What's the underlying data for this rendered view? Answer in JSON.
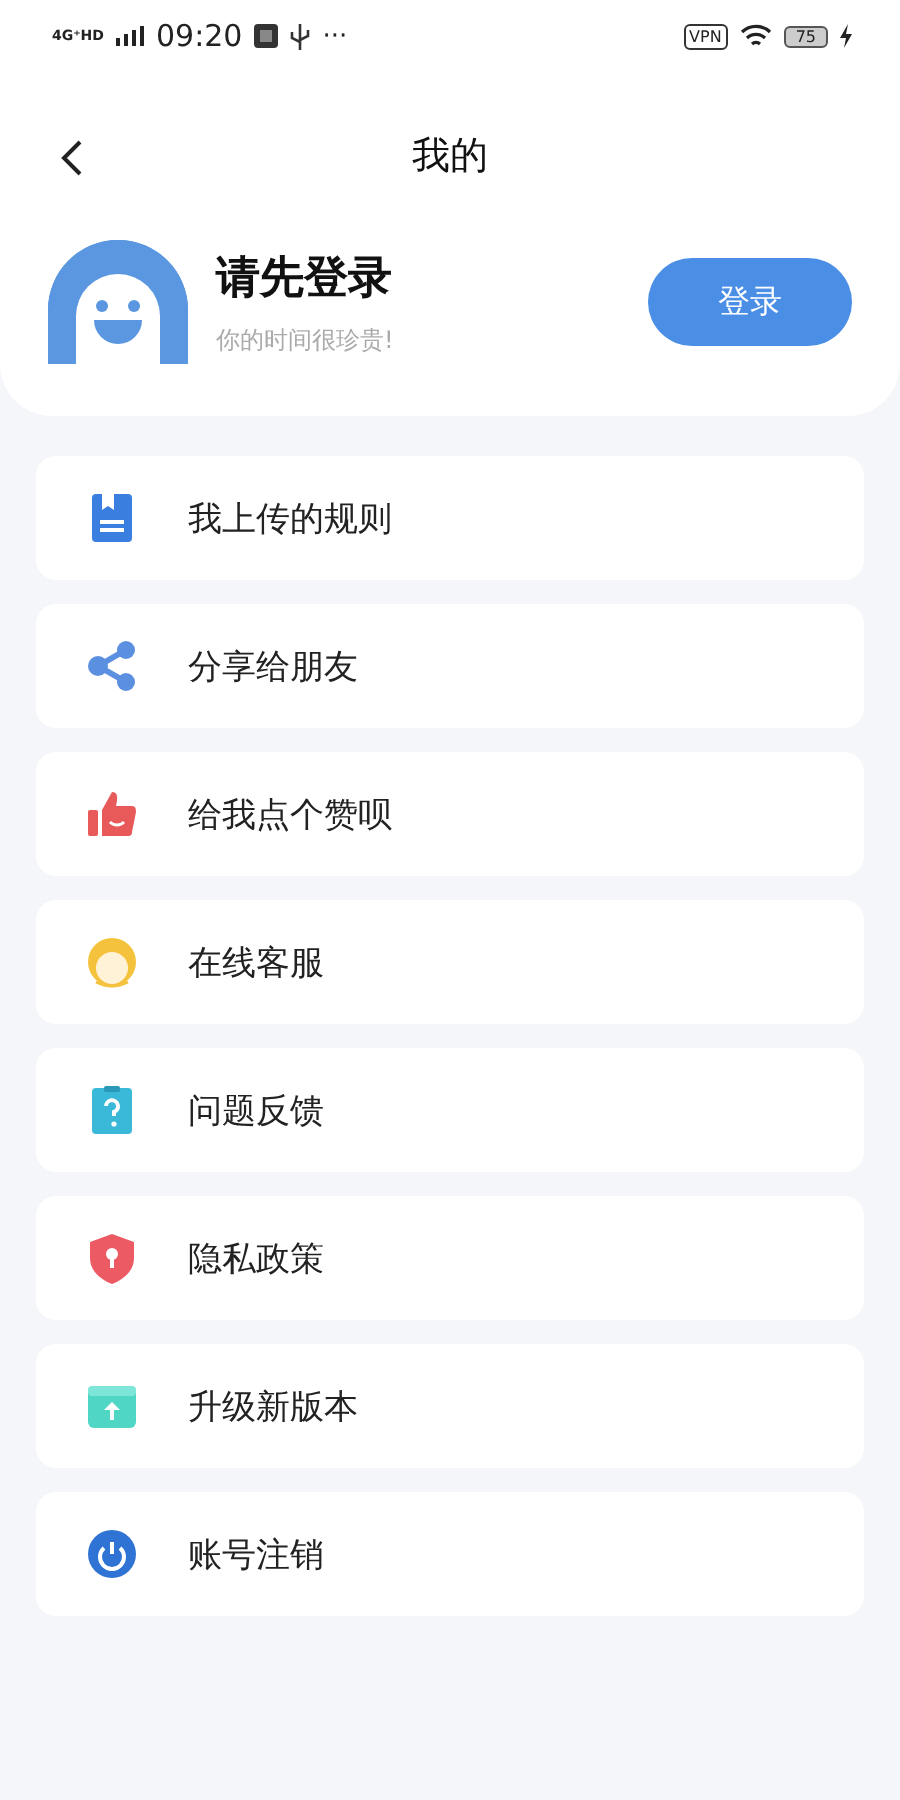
{
  "status_bar": {
    "network": "4G⁺HD",
    "time": "09:20",
    "more": "···",
    "vpn": "VPN",
    "battery": "75"
  },
  "header": {
    "title": "我的"
  },
  "profile": {
    "name": "请先登录",
    "subtitle": "你的时间很珍贵!",
    "login_button": "登录"
  },
  "menu": [
    {
      "kind": "rules",
      "label": "我上传的规则"
    },
    {
      "kind": "share",
      "label": "分享给朋友"
    },
    {
      "kind": "like",
      "label": "给我点个赞呗"
    },
    {
      "kind": "service",
      "label": "在线客服"
    },
    {
      "kind": "feedback",
      "label": "问题反馈"
    },
    {
      "kind": "privacy",
      "label": "隐私政策"
    },
    {
      "kind": "update",
      "label": "升级新版本"
    },
    {
      "kind": "logout",
      "label": "账号注销"
    }
  ]
}
